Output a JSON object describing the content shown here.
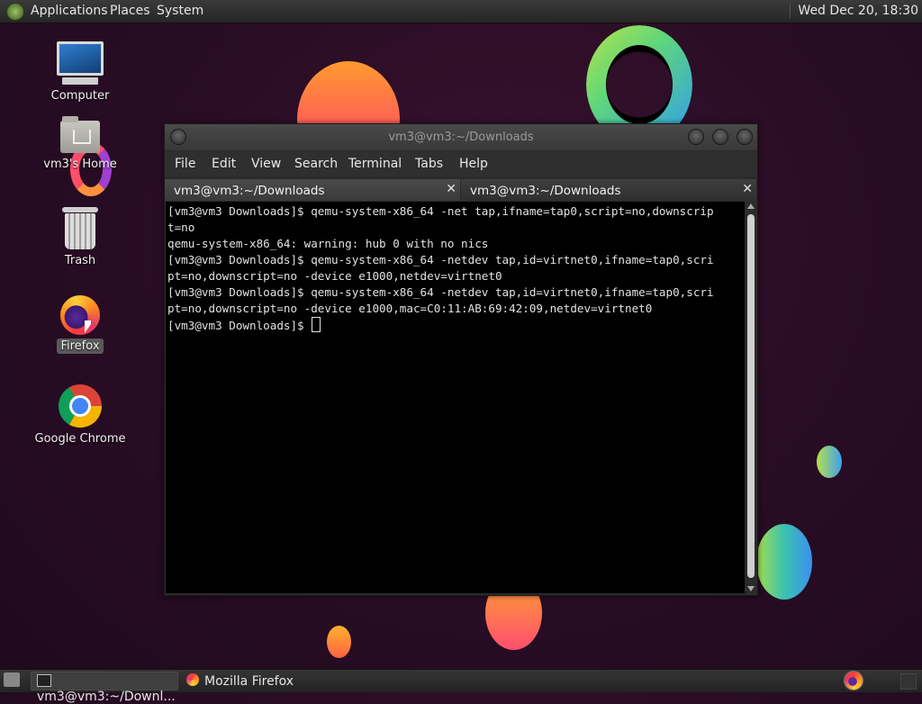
{
  "top_panel": {
    "menus": [
      "Applications",
      "Places",
      "System"
    ],
    "clock": "Wed Dec 20, 18:30"
  },
  "desktop": {
    "icons": [
      {
        "label": "Computer",
        "icon": "computer-icon"
      },
      {
        "label": "vm3's Home",
        "icon": "home-folder-icon"
      },
      {
        "label": "Trash",
        "icon": "trash-icon"
      },
      {
        "label": "Firefox",
        "icon": "firefox-icon"
      },
      {
        "label": "Google Chrome",
        "icon": "chrome-icon"
      }
    ]
  },
  "terminal": {
    "title": "vm3@vm3:~/Downloads",
    "menu": [
      "File",
      "Edit",
      "View",
      "Search",
      "Terminal",
      "Tabs",
      "Help"
    ],
    "tabs": [
      {
        "label": "vm3@vm3:~/Downloads"
      },
      {
        "label": "vm3@vm3:~/Downloads"
      }
    ],
    "lines": [
      "[vm3@vm3 Downloads]$ qemu-system-x86_64 -net tap,ifname=tap0,script=no,downscrip",
      "t=no",
      "qemu-system-x86_64: warning: hub 0 with no nics",
      "[vm3@vm3 Downloads]$ qemu-system-x86_64 -netdev tap,id=virtnet0,ifname=tap0,scri",
      "pt=no,downscript=no -device e1000,netdev=virtnet0",
      "[vm3@vm3 Downloads]$ qemu-system-x86_64 -netdev tap,id=virtnet0,ifname=tap0,scri",
      "pt=no,downscript=no -device e1000,mac=C0:11:AB:69:42:09,netdev=virtnet0"
    ],
    "prompt": "[vm3@vm3 Downloads]$ "
  },
  "bottom_panel": {
    "tasks": [
      {
        "label": "vm3@vm3:~/Downl...",
        "icon": "terminal-icon"
      },
      {
        "label": "Mozilla Firefox",
        "icon": "firefox-icon"
      }
    ]
  }
}
